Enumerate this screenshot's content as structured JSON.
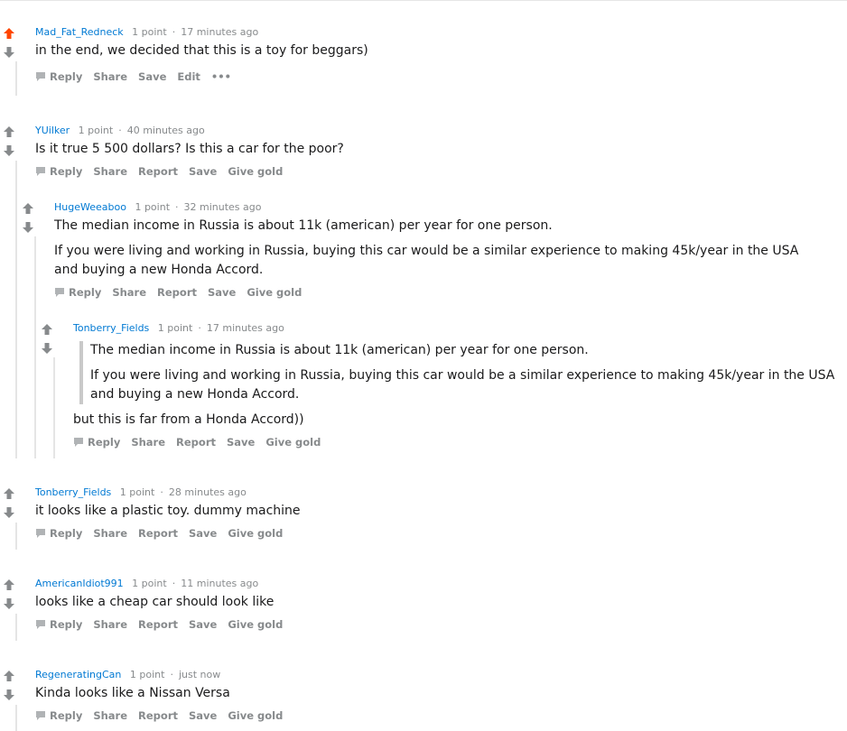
{
  "colors": {
    "upvoted": "#ff4500",
    "arrow": "#878a8c",
    "author": "#0079d3"
  },
  "comments": [
    {
      "author": "Mad_Fat_Redneck",
      "points": "1 point",
      "time": "17 minutes ago",
      "text": "in the end, we decided that this is a toy for beggars)",
      "actions": [
        "Reply",
        "Share",
        "Save",
        "Edit",
        "•••"
      ],
      "upvoted": true
    },
    {
      "author": "YUilker",
      "points": "1 point",
      "time": "40 minutes ago",
      "text": "Is it true 5 500 dollars? Is this a car for the poor?",
      "actions": [
        "Reply",
        "Share",
        "Report",
        "Save",
        "Give gold"
      ]
    },
    {
      "author": "HugeWeeaboo",
      "points": "1 point",
      "time": "32 minutes ago",
      "text": "The median income in Russia is about 11k (american) per year for one person.",
      "text2_line1": "If you were living and working in Russia, buying this car would be a similar experience to making 45k/year in the USA",
      "text2_line2": "and buying a new Honda Accord.",
      "actions": [
        "Reply",
        "Share",
        "Report",
        "Save",
        "Give gold"
      ]
    },
    {
      "author": "Tonberry_Fields",
      "points": "1 point",
      "time": "17 minutes ago",
      "quote1": "The median income in Russia is about 11k (american) per year for one person.",
      "quote2_line1": "If you were living and working in Russia, buying this car would be a similar experience to making 45k/year in the USA",
      "quote2_line2": "and buying a new Honda Accord.",
      "text": "but this is far from a Honda Accord))",
      "actions": [
        "Reply",
        "Share",
        "Report",
        "Save",
        "Give gold"
      ]
    },
    {
      "author": "Tonberry_Fields",
      "points": "1 point",
      "time": "28 minutes ago",
      "text": "it looks like a plastic toy. dummy machine",
      "actions": [
        "Reply",
        "Share",
        "Report",
        "Save",
        "Give gold"
      ]
    },
    {
      "author": "AmericanIdiot991",
      "points": "1 point",
      "time": "11 minutes ago",
      "text": "looks like a cheap car should look like",
      "actions": [
        "Reply",
        "Share",
        "Report",
        "Save",
        "Give gold"
      ]
    },
    {
      "author": "RegeneratingCan",
      "points": "1 point",
      "time": "just now",
      "text": "Kinda looks like a Nissan Versa",
      "actions": [
        "Reply",
        "Share",
        "Report",
        "Save",
        "Give gold"
      ]
    }
  ]
}
